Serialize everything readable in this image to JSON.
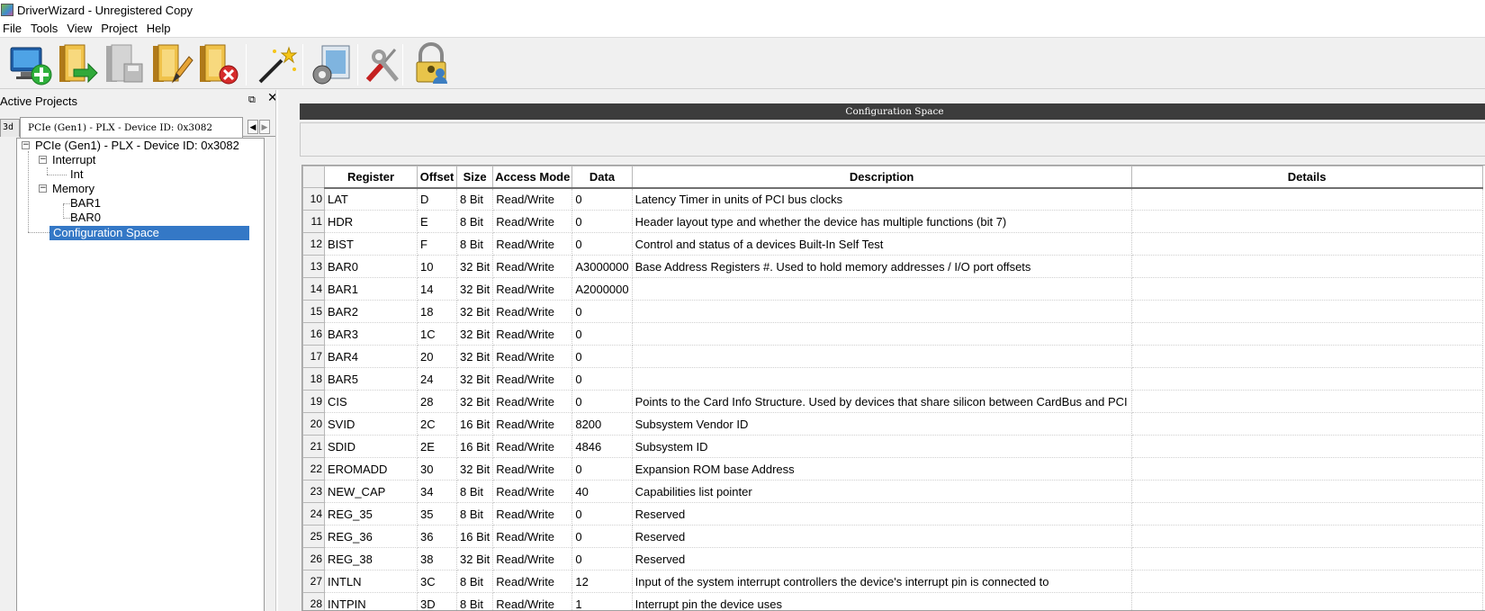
{
  "window": {
    "title": "DriverWizard - Unregistered Copy",
    "icon": "driverwizard-app-icon"
  },
  "menu": [
    "File",
    "Tools",
    "View",
    "Project",
    "Help"
  ],
  "toolbar": {
    "buttons": [
      {
        "name": "new-project-button",
        "icon": "monitor-plus-icon"
      },
      {
        "name": "open-project-button",
        "icon": "folder-arrow-icon"
      },
      {
        "name": "save-project-button",
        "icon": "folder-save-icon"
      },
      {
        "name": "edit-project-button",
        "icon": "folder-edit-icon"
      },
      {
        "name": "close-project-button",
        "icon": "folder-close-icon"
      },
      {
        "name": "generate-code-button",
        "icon": "magic-wand-icon"
      },
      {
        "name": "register-button",
        "icon": "gear-clipboard-icon"
      },
      {
        "name": "tools-button",
        "icon": "screwdriver-icon"
      },
      {
        "name": "security-button",
        "icon": "lock-user-icon"
      }
    ]
  },
  "left_pane": {
    "title": "Active Projects",
    "tabs": {
      "partial_label": "3d",
      "active_label": "PCIe (Gen1) - PLX - Device ID: 0x3082"
    },
    "tree": {
      "root": "PCIe (Gen1) - PLX - Device ID: 0x3082",
      "interrupt": "Interrupt",
      "interrupt_child": "Int",
      "memory": "Memory",
      "memory_children": [
        "BAR1",
        "BAR0"
      ],
      "config": "Configuration Space"
    }
  },
  "right_pane": {
    "header": "Configuration Space",
    "columns": [
      "Register",
      "Offset",
      "Size",
      "Access Mode",
      "Data",
      "Description",
      "Details"
    ],
    "rows": [
      {
        "num": "10",
        "register": "LAT",
        "offset": "D",
        "size": "8 Bit",
        "mode": "Read/Write",
        "data": "0",
        "description": "Latency Timer in units of PCI bus clocks",
        "details": ""
      },
      {
        "num": "11",
        "register": "HDR",
        "offset": "E",
        "size": "8 Bit",
        "mode": "Read/Write",
        "data": "0",
        "description": "Header layout type and whether the device has multiple functions (bit 7)",
        "details": ""
      },
      {
        "num": "12",
        "register": "BIST",
        "offset": "F",
        "size": "8 Bit",
        "mode": "Read/Write",
        "data": "0",
        "description": "Control and status of a devices Built-In Self Test",
        "details": ""
      },
      {
        "num": "13",
        "register": "BAR0",
        "offset": "10",
        "size": "32 Bit",
        "mode": "Read/Write",
        "data": "A3000000",
        "description": "Base Address Registers #. Used to hold memory addresses / I/O port offsets",
        "details": ""
      },
      {
        "num": "14",
        "register": "BAR1",
        "offset": "14",
        "size": "32 Bit",
        "mode": "Read/Write",
        "data": "A2000000",
        "description": "",
        "details": ""
      },
      {
        "num": "15",
        "register": "BAR2",
        "offset": "18",
        "size": "32 Bit",
        "mode": "Read/Write",
        "data": "0",
        "description": "",
        "details": ""
      },
      {
        "num": "16",
        "register": "BAR3",
        "offset": "1C",
        "size": "32 Bit",
        "mode": "Read/Write",
        "data": "0",
        "description": "",
        "details": ""
      },
      {
        "num": "17",
        "register": "BAR4",
        "offset": "20",
        "size": "32 Bit",
        "mode": "Read/Write",
        "data": "0",
        "description": "",
        "details": ""
      },
      {
        "num": "18",
        "register": "BAR5",
        "offset": "24",
        "size": "32 Bit",
        "mode": "Read/Write",
        "data": "0",
        "description": "",
        "details": ""
      },
      {
        "num": "19",
        "register": "CIS",
        "offset": "28",
        "size": "32 Bit",
        "mode": "Read/Write",
        "data": "0",
        "description": "Points to the Card Info Structure. Used by devices that share silicon between CardBus and PCI",
        "details": ""
      },
      {
        "num": "20",
        "register": "SVID",
        "offset": "2C",
        "size": "16 Bit",
        "mode": "Read/Write",
        "data": "8200",
        "description": "Subsystem Vendor ID",
        "details": ""
      },
      {
        "num": "21",
        "register": "SDID",
        "offset": "2E",
        "size": "16 Bit",
        "mode": "Read/Write",
        "data": "4846",
        "description": "Subsystem ID",
        "details": ""
      },
      {
        "num": "22",
        "register": "EROMADD",
        "offset": "30",
        "size": "32 Bit",
        "mode": "Read/Write",
        "data": "0",
        "description": "Expansion ROM base Address",
        "details": ""
      },
      {
        "num": "23",
        "register": "NEW_CAP",
        "offset": "34",
        "size": "8 Bit",
        "mode": "Read/Write",
        "data": "40",
        "description": "Capabilities list pointer",
        "details": ""
      },
      {
        "num": "24",
        "register": "REG_35",
        "offset": "35",
        "size": "8 Bit",
        "mode": "Read/Write",
        "data": "0",
        "description": "Reserved",
        "details": ""
      },
      {
        "num": "25",
        "register": "REG_36",
        "offset": "36",
        "size": "16 Bit",
        "mode": "Read/Write",
        "data": "0",
        "description": "Reserved",
        "details": ""
      },
      {
        "num": "26",
        "register": "REG_38",
        "offset": "38",
        "size": "32 Bit",
        "mode": "Read/Write",
        "data": "0",
        "description": "Reserved",
        "details": ""
      },
      {
        "num": "27",
        "register": "INTLN",
        "offset": "3C",
        "size": "8 Bit",
        "mode": "Read/Write",
        "data": "12",
        "description": "Input of the system interrupt controllers the device's interrupt pin is connected to",
        "details": ""
      },
      {
        "num": "28",
        "register": "INTPIN",
        "offset": "3D",
        "size": "8 Bit",
        "mode": "Read/Write",
        "data": "1",
        "description": "Interrupt pin the device uses",
        "details": ""
      }
    ]
  },
  "colors": {
    "selection": "#3478c6",
    "header_bar": "#3c3c3c"
  }
}
